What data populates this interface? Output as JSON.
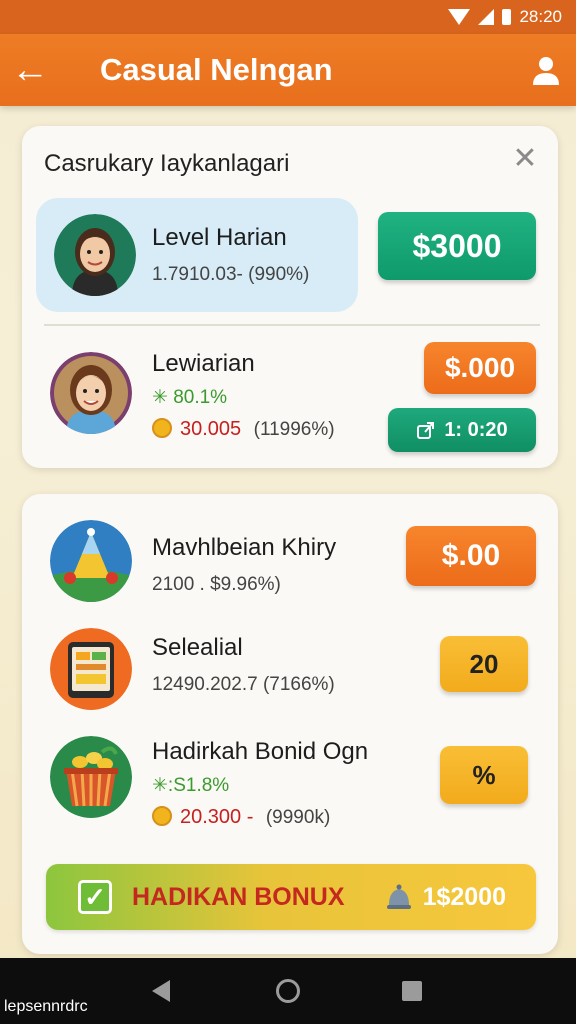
{
  "status_bar": {
    "time": "28:20"
  },
  "app_bar": {
    "back_icon": "arrow-left-icon",
    "title": "Casual Nelngan",
    "profile_icon": "person-icon"
  },
  "card1": {
    "title": "Casrukary Iaykanlagari",
    "items": [
      {
        "title": "Level Harian",
        "subtitle": "1.7910.03- (990%)",
        "button": "$3000"
      },
      {
        "title": "Lewiarian",
        "green": "✳ 80.1%",
        "red": "30.005",
        "gray": "(11996%)",
        "button_top": "$.000",
        "button_bottom": "1: 0:20"
      }
    ]
  },
  "card2": {
    "items": [
      {
        "title": "Mavhlbeian Khiry",
        "subtitle": "2100 . $9.96%)",
        "button": "$.00"
      },
      {
        "title": "Selealial",
        "subtitle": "12490.202.7 (7166%)",
        "button": "20"
      },
      {
        "title": "Hadirkah Bonid Ogn",
        "green": "✳:S1.8%",
        "red": "20.300 -",
        "gray": "(9990k)",
        "button": "%"
      }
    ],
    "bonus": {
      "label": "HADIKAN BONUX",
      "amount": "1$2000"
    }
  },
  "nav_bar": {
    "label": "lepsennrdrc"
  },
  "colors": {
    "accent": "#e86f1d",
    "green": "#0f9a6b",
    "orange": "#ec6c1a",
    "yellow": "#f2ab1c"
  }
}
